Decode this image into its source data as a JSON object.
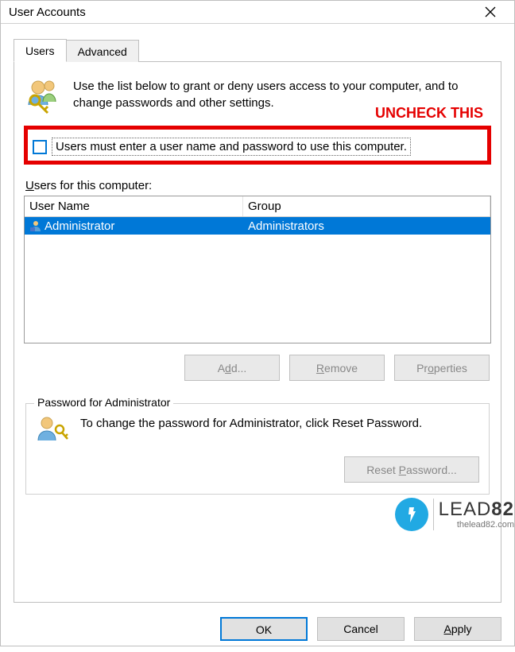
{
  "window": {
    "title": "User Accounts"
  },
  "tabs": {
    "users": "Users",
    "advanced": "Advanced"
  },
  "intro": {
    "text": "Use the list below to grant or deny users access to your computer, and to change passwords and other settings."
  },
  "annotation": {
    "label": "UNCHECK THIS"
  },
  "checkbox": {
    "label": "Users must enter a user name and password to use this computer.",
    "checked": false
  },
  "section": {
    "users_label_prefix": "U",
    "users_label_rest": "sers for this computer:"
  },
  "list": {
    "col_user": "User Name",
    "col_group": "Group",
    "rows": [
      {
        "user": "Administrator",
        "group": "Administrators",
        "selected": true
      }
    ]
  },
  "buttons": {
    "add": "Add...",
    "add_ul": "d",
    "remove": "Remove",
    "remove_ul": "R",
    "properties": "Properties",
    "properties_ul": "o",
    "add_label_html": "A<u>d</u>d...",
    "remove_label_html": "<u>R</u>emove",
    "properties_label_html": "Pr<u>o</u>perties"
  },
  "groupbox": {
    "title": "Password for Administrator",
    "text": "To change the password for Administrator, click Reset Password.",
    "reset_label": "Reset Password...",
    "reset_ul": "P"
  },
  "footer": {
    "ok": "OK",
    "cancel": "Cancel",
    "apply": "Apply",
    "apply_ul": "A"
  },
  "watermark": {
    "brand_a": "LEAD",
    "brand_b": "82",
    "url": "thelead82.com"
  }
}
